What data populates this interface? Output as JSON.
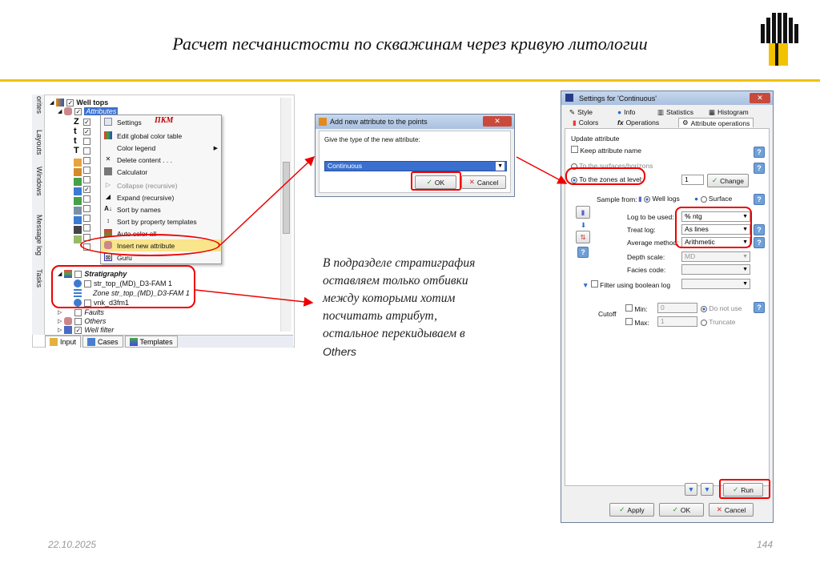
{
  "page": {
    "title": "Расчет песчанистости по скважинам через кривую литологии",
    "date": "22.10.2025",
    "page_number": "144",
    "description": [
      "В подразделе стратиграфия",
      "оставляем только отбивки",
      "между которыми хотим",
      "посчитать атрибут,",
      "остальное перекидываем в",
      "Others"
    ]
  },
  "left_panel": {
    "vertical_tabs": [
      "orites",
      "Layouts",
      "Windows",
      "Message log",
      "Tasks"
    ],
    "tree": {
      "well_tops": "Well tops",
      "attributes": "Attributes",
      "stratigraphy": "Stratigraphy",
      "strat_items": [
        "str_top_(MD)_D3-FAM 1",
        "Zone str_top_(MD)_D3-FAM 1",
        "vnk_d3fm1"
      ],
      "faults": "Faults",
      "others": "Others",
      "well_filter": "Well filter"
    },
    "bottom_tabs": [
      "Input",
      "Cases",
      "Templates"
    ]
  },
  "context_menu": {
    "annotation": "ПКМ",
    "items": [
      {
        "label": "Settings",
        "icon": "settings-icon"
      },
      {
        "label": "Edit global color table",
        "icon": "color-table-icon"
      },
      {
        "label": "Color legend",
        "icon": "legend-icon"
      },
      {
        "label": "Delete content . . .",
        "icon": "delete-icon"
      },
      {
        "label": "Calculator",
        "icon": "calculator-icon"
      },
      {
        "label": "Collapse (recursive)",
        "icon": "collapse-icon"
      },
      {
        "label": "Expand (recursive)",
        "icon": "expand-icon"
      },
      {
        "label": "Sort by names",
        "icon": "sort-names-icon"
      },
      {
        "label": "Sort by property templates",
        "icon": "sort-templates-icon"
      },
      {
        "label": "Auto color all",
        "icon": "auto-color-icon"
      },
      {
        "label": "Insert new attribute",
        "icon": "insert-attribute-icon"
      },
      {
        "label": "Guru",
        "icon": "guru-icon"
      }
    ]
  },
  "dialog_add_attribute": {
    "title": "Add new attribute to the points",
    "prompt": "Give the type of the new attribute:",
    "selected": "Continuous",
    "ok": "OK",
    "cancel": "Cancel"
  },
  "dialog_settings": {
    "title": "Settings for 'Continuous'",
    "tabs_row1": [
      "Style",
      "Info",
      "Statistics",
      "Histogram"
    ],
    "tabs_row2": [
      "Colors",
      "Operations",
      "Attribute operations"
    ],
    "update_attribute": "Update attribute",
    "keep_name": "Keep attribute name",
    "to_surfaces": "To the surfaces/horizons",
    "to_zones": "To the zones at level:",
    "level_value": "1",
    "change": "Change",
    "sample_from": "Sample from:",
    "well_logs": "Well logs",
    "surface": "Surface",
    "log_to_be_used": "Log to be used:",
    "log_value": "ntg",
    "treat_log": "Treat log:",
    "treat_value": "As lines",
    "average_method": "Average method:",
    "average_value": "Arithmetic",
    "depth_scale": "Depth scale:",
    "depth_value": "MD",
    "facies_code": "Facies code:",
    "filter_boolean": "Filter using boolean log",
    "cutoff": "Cutoff",
    "min": "Min:",
    "min_value": "0",
    "max": "Max:",
    "max_value": "1",
    "do_not_use": "Do not use",
    "truncate": "Truncate",
    "run": "Run",
    "apply": "Apply",
    "ok": "OK",
    "cancel": "Cancel"
  },
  "colors": {
    "accent_yellow": "#f2c200",
    "annotation_red": "#e00000",
    "highlight": "#f8e58c"
  }
}
